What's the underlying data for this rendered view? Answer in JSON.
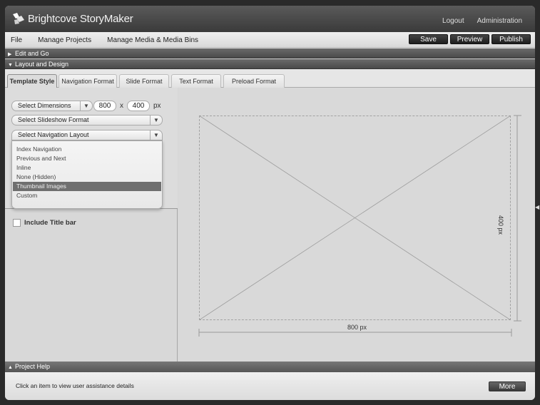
{
  "app": {
    "title": "Brightcove StoryMaker"
  },
  "top_links": {
    "logout": "Logout",
    "administration": "Administration"
  },
  "menu": {
    "items": [
      "File",
      "Manage Projects",
      "Manage Media & Media Bins"
    ],
    "save": "Save",
    "preview": "Preview",
    "publish": "Publish"
  },
  "sections": {
    "edit_and_go": "Edit and Go",
    "layout_and_design": "Layout and Design",
    "project_help": "Project Help"
  },
  "tabs": [
    "Template Style",
    "Navigation Format",
    "Slide Format",
    "Text Format",
    "Preload Format"
  ],
  "template_style": {
    "dimensions_label": "Select Dimensions",
    "width": "800",
    "times": "x",
    "height": "400",
    "unit": "px",
    "slideshow_format": "Select Slideshow Format",
    "navigation_layout": "Select Navigation Layout",
    "nav_options": [
      "Index Navigation",
      "Previous and Next",
      "Inline",
      "None (Hidden)",
      "Thumbnail Images",
      "Custom"
    ],
    "selected_option": "Thumbnail Images",
    "include_title_bar": "Include Title bar"
  },
  "canvas": {
    "width_label": "800 px",
    "height_label": "400 px"
  },
  "help": {
    "text": "Click an item to view user assistance details",
    "more": "More"
  },
  "icons": {
    "logo": "brightcove-logo-icon",
    "dropdown": "chevron-down-icon",
    "collapsed": "triangle-right-icon",
    "expanded": "triangle-down-icon"
  }
}
